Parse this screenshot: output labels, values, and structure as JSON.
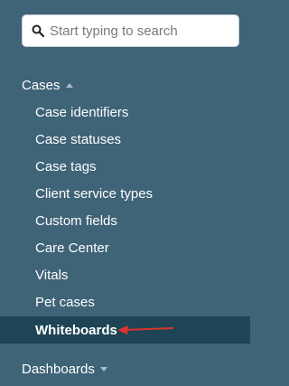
{
  "search": {
    "placeholder": "Start typing to search"
  },
  "sections": {
    "cases": {
      "label": "Cases",
      "state": "expanded"
    },
    "dashboards": {
      "label": "Dashboards",
      "state": "collapsed"
    }
  },
  "cases_items": [
    {
      "label": "Case identifiers"
    },
    {
      "label": "Case statuses"
    },
    {
      "label": "Case tags"
    },
    {
      "label": "Client service types"
    },
    {
      "label": "Custom fields"
    },
    {
      "label": "Care Center"
    },
    {
      "label": "Vitals"
    },
    {
      "label": "Pet cases"
    },
    {
      "label": "Whiteboards",
      "active": true
    }
  ],
  "colors": {
    "sidebar_bg": "#3f6377",
    "active_bg": "#1e4455",
    "annotation_arrow": "#d9342b"
  },
  "icons": {
    "search": "search-icon",
    "annotation": "red-arrow-annotation"
  }
}
